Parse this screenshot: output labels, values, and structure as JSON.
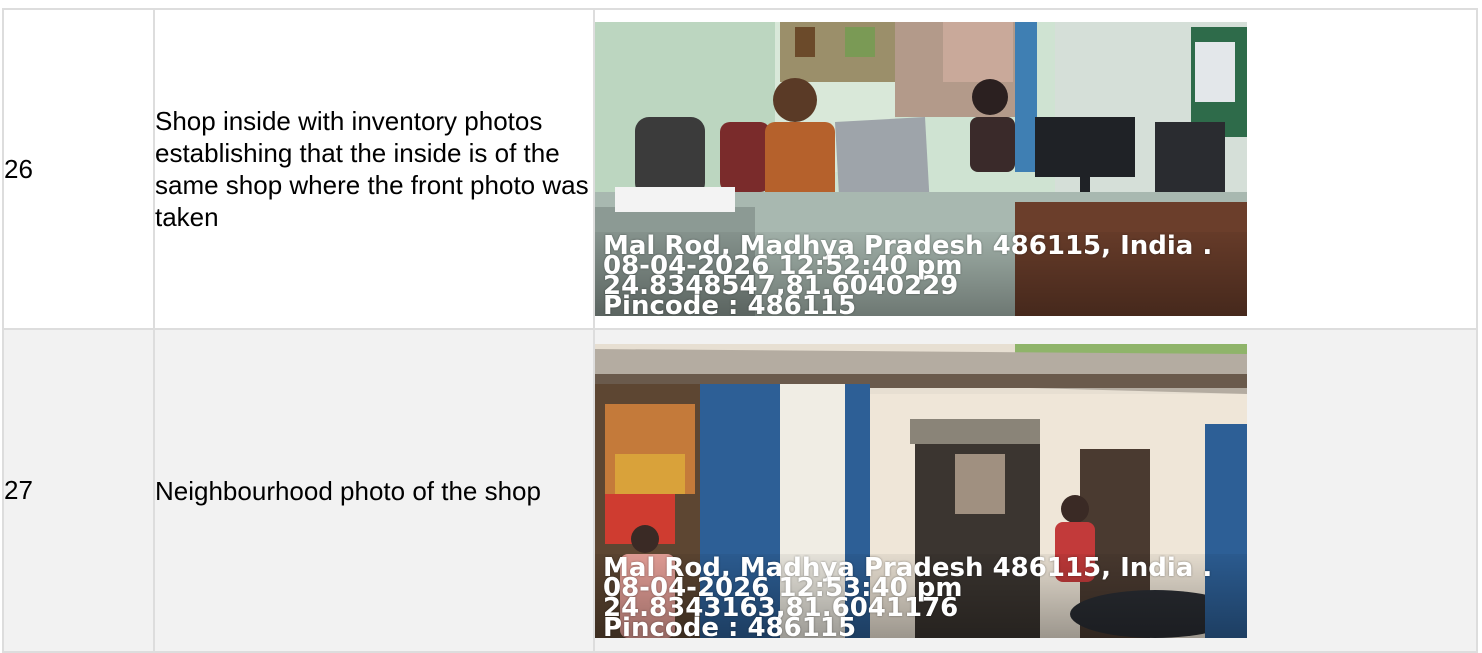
{
  "rows": [
    {
      "number": "26",
      "description": "Shop inside with inventory photos establishing that the inside is of the same shop where the front photo was taken",
      "photo": {
        "subject": "shop-interior-photo",
        "stamp": {
          "address": "Mal Rod, Madhya Pradesh 486115, India .",
          "datetime": "08-04-2026 12:52:40 pm",
          "coordinates": "24.8348547,81.6040229",
          "pincode": "Pincode : 486115"
        }
      }
    },
    {
      "number": "27",
      "description": "Neighbourhood photo of the shop",
      "photo": {
        "subject": "shop-neighbourhood-photo",
        "stamp": {
          "address": "Mal Rod, Madhya Pradesh 486115, India .",
          "datetime": "08-04-2026 12:53:40 pm",
          "coordinates": "24.8343163,81.6041176",
          "pincode": "Pincode : 486115"
        }
      }
    }
  ]
}
